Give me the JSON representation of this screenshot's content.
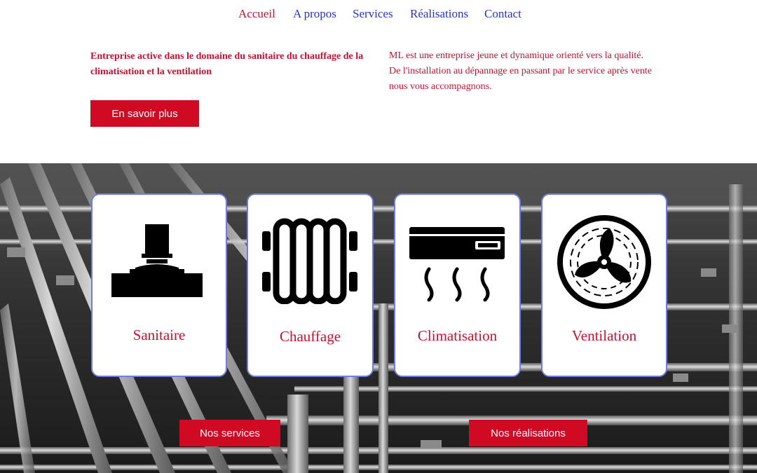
{
  "nav": {
    "items": [
      {
        "label": "Accueil"
      },
      {
        "label": "A propos"
      },
      {
        "label": "Services"
      },
      {
        "label": "Réalisations"
      },
      {
        "label": "Contact"
      }
    ]
  },
  "intro": {
    "left_text": "Entreprise active dans le domaine du sanitaire  du chauffage de la climatisation et la ventilation",
    "right_lines": [
      "ML est une entreprise jeune et dynamique orienté vers la qualité.",
      "De l'installation au dépannage en passant par le service après vente",
      "nous vous accompagnons."
    ],
    "cta_label": "En savoir plus"
  },
  "services": {
    "cards": [
      {
        "label": "Sanitaire",
        "icon": "pipe-tee-icon"
      },
      {
        "label": "Chauffage",
        "icon": "radiator-icon"
      },
      {
        "label": "Climatisation",
        "icon": "air-conditioner-icon"
      },
      {
        "label": "Ventilation",
        "icon": "fan-icon"
      }
    ],
    "services_button": "Nos services",
    "realisations_button": "Nos réalisations"
  },
  "colors": {
    "accent": "#c8102e",
    "button": "#d10a24",
    "nav_link": "#2435c8",
    "card_border": "#6f7de0"
  }
}
